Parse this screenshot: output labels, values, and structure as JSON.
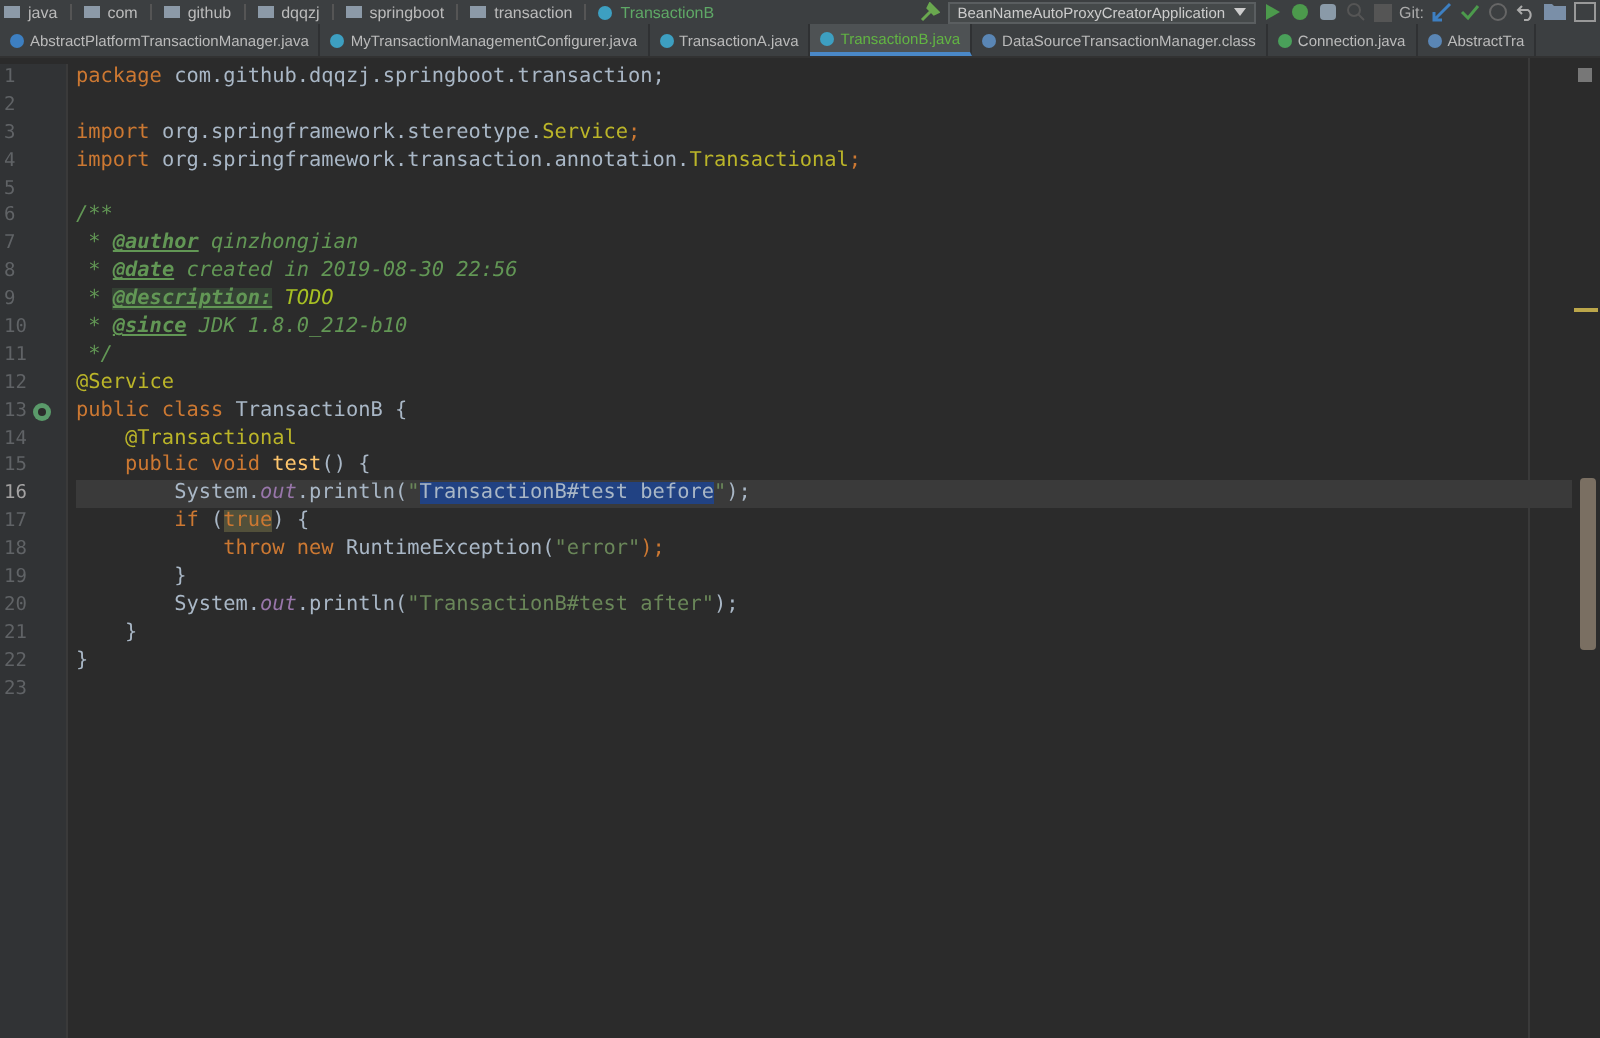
{
  "breadcrumbs": [
    {
      "label": "java",
      "kind": "folder"
    },
    {
      "label": "com",
      "kind": "folder"
    },
    {
      "label": "github",
      "kind": "folder"
    },
    {
      "label": "dqqzj",
      "kind": "folder"
    },
    {
      "label": "springboot",
      "kind": "folder"
    },
    {
      "label": "transaction",
      "kind": "folder"
    },
    {
      "label": "TransactionB",
      "kind": "class"
    }
  ],
  "toolbar": {
    "run_config": "BeanNameAutoProxyCreatorApplication",
    "vcs_label": "Git:"
  },
  "tabs": [
    {
      "label": "AbstractPlatformTransactionManager.java",
      "selected": false,
      "kind": "file"
    },
    {
      "label": "MyTransactionManagementConfigurer.java",
      "selected": false,
      "kind": "class"
    },
    {
      "label": "TransactionA.java",
      "selected": false,
      "kind": "class"
    },
    {
      "label": "TransactionB.java",
      "selected": true,
      "kind": "class"
    },
    {
      "label": "DataSourceTransactionManager.class",
      "selected": false,
      "kind": "compiled"
    },
    {
      "label": "Connection.java",
      "selected": false,
      "kind": "interface"
    },
    {
      "label": "AbstractTra",
      "selected": false,
      "kind": "compiled"
    }
  ],
  "editor": {
    "lines": [
      {
        "number": "1",
        "current": false,
        "tokens": [
          {
            "t": "package",
            "kind": "kw"
          },
          {
            "t": " com.github.dqqzj.springboot.transaction;",
            "kind": "plain"
          }
        ]
      },
      {
        "number": "2",
        "current": false
      },
      {
        "number": "3",
        "current": false,
        "tokens": [
          {
            "t": "import",
            "kind": "kw"
          },
          {
            "t": " org.springframework.stereotype.",
            "kind": "plain"
          },
          {
            "t": "Service",
            "kind": "ann"
          },
          {
            "t": ";",
            "kind": "kw"
          }
        ]
      },
      {
        "number": "4",
        "current": false,
        "tokens": [
          {
            "t": "import",
            "kind": "kw"
          },
          {
            "t": " org.springframework.transaction.annotation.",
            "kind": "plain"
          },
          {
            "t": "Transactional",
            "kind": "ann"
          },
          {
            "t": ";",
            "kind": "kw"
          }
        ]
      },
      {
        "number": "5",
        "current": false
      },
      {
        "number": "6",
        "current": false,
        "tokens": [
          {
            "t": "/**",
            "kind": "doc"
          }
        ]
      },
      {
        "number": "7",
        "current": false,
        "tokens": [
          {
            "t": " * ",
            "kind": "doc"
          },
          {
            "t": "@author",
            "kind": "doctag"
          },
          {
            "t": " qinzhongjian",
            "kind": "doc"
          }
        ]
      },
      {
        "number": "8",
        "current": false,
        "tokens": [
          {
            "t": " * ",
            "kind": "doc"
          },
          {
            "t": "@date",
            "kind": "doctag"
          },
          {
            "t": " created in 2019-08-30 22:56",
            "kind": "doc"
          }
        ]
      },
      {
        "number": "9",
        "current": false,
        "tokens": [
          {
            "t": " * ",
            "kind": "doc"
          },
          {
            "t": "@description:",
            "kind": "doctagbg"
          },
          {
            "t": " TODO",
            "kind": "todo"
          }
        ]
      },
      {
        "number": "10",
        "current": false,
        "tokens": [
          {
            "t": " * ",
            "kind": "doc"
          },
          {
            "t": "@since",
            "kind": "doctag"
          },
          {
            "t": " JDK 1.8.0_212-b10",
            "kind": "doc"
          }
        ]
      },
      {
        "number": "11",
        "current": false,
        "tokens": [
          {
            "t": " */",
            "kind": "doc"
          }
        ]
      },
      {
        "number": "12",
        "current": false,
        "tokens": [
          {
            "t": "@Service",
            "kind": "ann"
          }
        ]
      },
      {
        "number": "13",
        "current": false,
        "bean_marker": true,
        "tokens": [
          {
            "t": "public class",
            "kind": "kw"
          },
          {
            "t": " TransactionB {",
            "kind": "plain"
          }
        ]
      },
      {
        "number": "14",
        "current": false,
        "tokens": [
          {
            "t": "    @Transactional",
            "kind": "ann"
          }
        ]
      },
      {
        "number": "15",
        "current": false,
        "tokens": [
          {
            "t": "    public void ",
            "kind": "kw"
          },
          {
            "t": "test",
            "kind": "method"
          },
          {
            "t": "() {",
            "kind": "plain"
          }
        ]
      },
      {
        "number": "16",
        "current": true,
        "tokens": [
          {
            "t": "        System.",
            "kind": "plain"
          },
          {
            "t": "out",
            "kind": "field"
          },
          {
            "t": ".println(",
            "kind": "plain"
          },
          {
            "t": "\"",
            "kind": "str"
          },
          {
            "t": "TransactionB#test before",
            "kind": "sel"
          },
          {
            "t": "\"",
            "kind": "str"
          },
          {
            "t": ");",
            "kind": "plain"
          }
        ]
      },
      {
        "number": "17",
        "current": false,
        "tokens": [
          {
            "t": "        if",
            "kind": "kw"
          },
          {
            "t": " (",
            "kind": "plain"
          },
          {
            "t": "true",
            "kind": "kwbg"
          },
          {
            "t": ") {",
            "kind": "plain"
          }
        ]
      },
      {
        "number": "18",
        "current": false,
        "tokens": [
          {
            "t": "            throw new",
            "kind": "kw"
          },
          {
            "t": " RuntimeException(",
            "kind": "plain"
          },
          {
            "t": "\"error\"",
            "kind": "str"
          },
          {
            "t": ");",
            "kind": "kw"
          }
        ]
      },
      {
        "number": "19",
        "current": false,
        "tokens": [
          {
            "t": "        }",
            "kind": "plain"
          }
        ]
      },
      {
        "number": "20",
        "current": false,
        "tokens": [
          {
            "t": "        System.",
            "kind": "plain"
          },
          {
            "t": "out",
            "kind": "field"
          },
          {
            "t": ".println(",
            "kind": "plain"
          },
          {
            "t": "\"TransactionB#test after\"",
            "kind": "str"
          },
          {
            "t": ");",
            "kind": "plain"
          }
        ]
      },
      {
        "number": "21",
        "current": false,
        "tokens": [
          {
            "t": "    }",
            "kind": "plain"
          }
        ]
      },
      {
        "number": "22",
        "current": false,
        "tokens": [
          {
            "t": "}",
            "kind": "plain"
          }
        ]
      },
      {
        "number": "23",
        "current": false
      }
    ]
  }
}
